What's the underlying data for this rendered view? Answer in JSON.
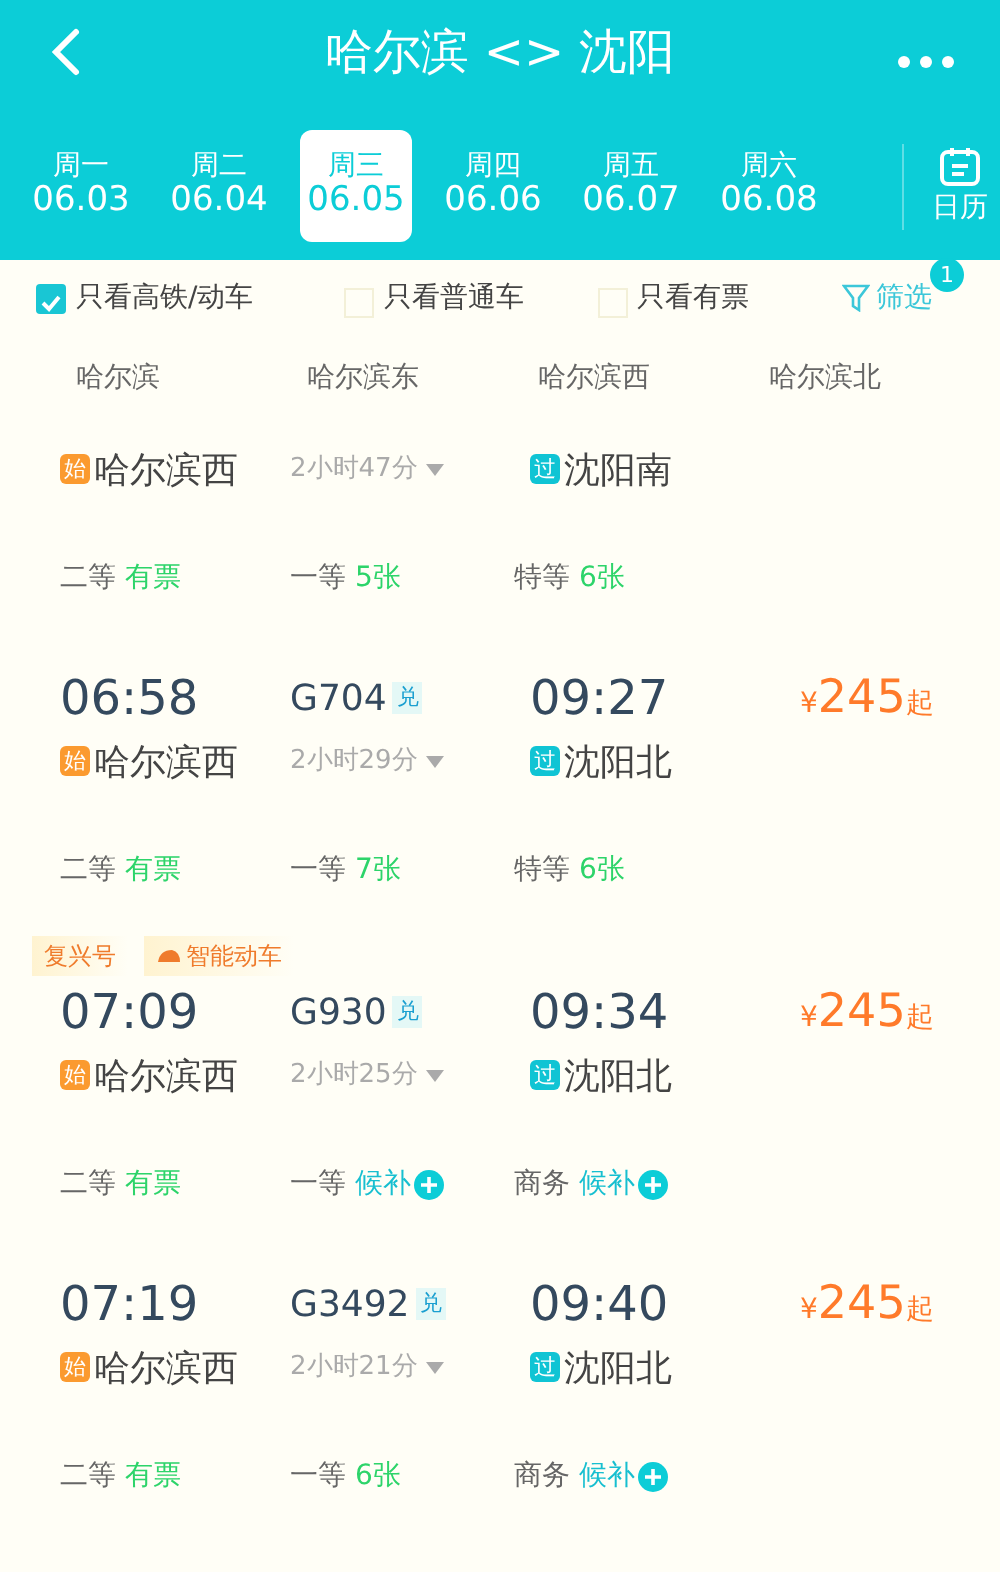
{
  "header": {
    "title": "哈尔滨 <> 沈阳"
  },
  "dates": [
    {
      "weekday": "周一",
      "date": "06.03",
      "selected": false
    },
    {
      "weekday": "周二",
      "date": "06.04",
      "selected": false
    },
    {
      "weekday": "周三",
      "date": "06.05",
      "selected": true
    },
    {
      "weekday": "周四",
      "date": "06.06",
      "selected": false
    },
    {
      "weekday": "周五",
      "date": "06.07",
      "selected": false
    },
    {
      "weekday": "周六",
      "date": "06.08",
      "selected": false
    }
  ],
  "calendar": {
    "label": "日历"
  },
  "filters": [
    {
      "label": "只看高铁/动车",
      "checked": true
    },
    {
      "label": "只看普通车",
      "checked": false
    },
    {
      "label": "只看有票",
      "checked": false
    }
  ],
  "filter_button": {
    "label": "筛选",
    "count": "1"
  },
  "station_tabs": [
    "哈尔滨",
    "哈尔滨东",
    "哈尔滨西",
    "哈尔滨北"
  ],
  "trains": [
    {
      "from": {
        "badge": "始",
        "kind": "start",
        "name": "哈尔滨西"
      },
      "duration": "2小时47分",
      "to": {
        "badge": "过",
        "kind": "pass",
        "name": "沈阳南"
      },
      "seats": [
        {
          "class": "二等",
          "status": "有票",
          "kind": "available"
        },
        {
          "class": "一等",
          "status": "5张",
          "kind": "available"
        },
        {
          "class": "特等",
          "status": "6张",
          "kind": "available"
        }
      ]
    },
    {
      "depart": "06:58",
      "train_no": "G704",
      "exchange": "兑",
      "arrive": "09:27",
      "price": {
        "symbol": "¥",
        "amount": "245",
        "suffix": "起"
      },
      "from": {
        "badge": "始",
        "kind": "start",
        "name": "哈尔滨西"
      },
      "duration": "2小时29分",
      "to": {
        "badge": "过",
        "kind": "pass",
        "name": "沈阳北"
      },
      "seats": [
        {
          "class": "二等",
          "status": "有票",
          "kind": "available"
        },
        {
          "class": "一等",
          "status": "7张",
          "kind": "available"
        },
        {
          "class": "特等",
          "status": "6张",
          "kind": "available"
        }
      ]
    },
    {
      "tags": [
        {
          "label": "复兴号",
          "kind": "plain"
        },
        {
          "label": "智能动车",
          "kind": "train"
        }
      ],
      "depart": "07:09",
      "train_no": "G930",
      "exchange": "兑",
      "arrive": "09:34",
      "price": {
        "symbol": "¥",
        "amount": "245",
        "suffix": "起"
      },
      "from": {
        "badge": "始",
        "kind": "start",
        "name": "哈尔滨西"
      },
      "duration": "2小时25分",
      "to": {
        "badge": "过",
        "kind": "pass",
        "name": "沈阳北"
      },
      "seats": [
        {
          "class": "二等",
          "status": "有票",
          "kind": "available"
        },
        {
          "class": "一等",
          "status": "候补",
          "kind": "waitlist"
        },
        {
          "class": "商务",
          "status": "候补",
          "kind": "waitlist"
        }
      ]
    },
    {
      "depart": "07:19",
      "train_no": "G3492",
      "exchange": "兑",
      "arrive": "09:40",
      "price": {
        "symbol": "¥",
        "amount": "245",
        "suffix": "起"
      },
      "from": {
        "badge": "始",
        "kind": "start",
        "name": "哈尔滨西"
      },
      "duration": "2小时21分",
      "to": {
        "badge": "过",
        "kind": "pass",
        "name": "沈阳北"
      },
      "seats": [
        {
          "class": "二等",
          "status": "有票",
          "kind": "available"
        },
        {
          "class": "一等",
          "status": "6张",
          "kind": "available"
        },
        {
          "class": "商务",
          "status": "候补",
          "kind": "waitlist"
        }
      ]
    }
  ]
}
